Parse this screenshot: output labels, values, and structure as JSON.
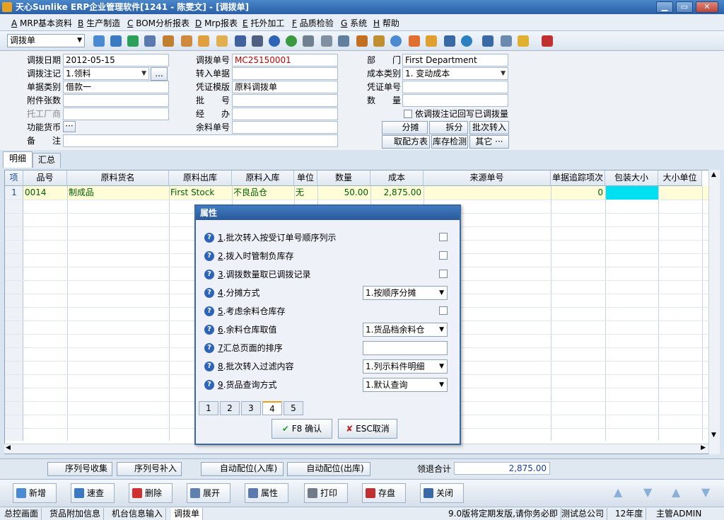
{
  "window": {
    "title": "天心Sunlike ERP企业管理软件[1241 - 陈雯文] - [调拨单]"
  },
  "menu": [
    {
      "key": "A",
      "label": "MRP基本资料"
    },
    {
      "key": "B",
      "label": "生产制造"
    },
    {
      "key": "C",
      "label": "BOM分析报表"
    },
    {
      "key": "D",
      "label": "Mrp报表"
    },
    {
      "key": "E",
      "label": "托外加工"
    },
    {
      "key": "F",
      "label": "品质检验"
    },
    {
      "key": "G",
      "label": "系统"
    },
    {
      "key": "H",
      "label": "帮助"
    }
  ],
  "toolbar": {
    "doc_type": "调拨单"
  },
  "form": {
    "date_label": "调拨日期",
    "date_value": "2012-05-15",
    "post_label": "调拨注记",
    "post_value": "1.领料",
    "post_btn": "...",
    "billtype_label": "单据类别",
    "billtype_value": "借款一",
    "attach_label": "附件张数",
    "attach_value": "",
    "tg_label": "托工厂商",
    "tg_value": "",
    "currency_label": "功能货币",
    "currency_btn": "···",
    "remark_label": "备　　注",
    "remark_value": "",
    "no_label": "调拨单号",
    "no_value": "MC25150001",
    "in_label": "转入单据",
    "in_value": "",
    "voucher_tpl_label": "凭证模版",
    "voucher_tpl_value": "原料调拨单",
    "batch_label": "批　　号",
    "batch_value": "",
    "handler_label": "经　　办",
    "handler_value": "",
    "remain_label": "余料单号",
    "remain_value": "",
    "dept_label": "部　　门",
    "dept_value": "First Department",
    "costtype_label": "成本类别",
    "costtype_value": "1. 变动成本",
    "voucher_no_label": "凭证单号",
    "voucher_no_value": "",
    "qty_label": "数　　量",
    "qty_value": "",
    "writeback_label": "依调拨注记回写已调拨量",
    "btn_split": "分摊",
    "btn_disassemble": "拆分",
    "btn_batch_in": "批次转入",
    "btn_recipe": "取配方表",
    "btn_stock_check": "库存检测",
    "btn_other": "其它 ···"
  },
  "tabs": [
    "明细",
    "汇总"
  ],
  "grid": {
    "headers": [
      "项",
      "品号",
      "原料货名",
      "原料出库",
      "原料入库",
      "单位",
      "数量",
      "成本",
      "来源单号",
      "单据追踪项次",
      "包装大小",
      "大小单位"
    ],
    "rows": [
      {
        "idx": "1",
        "code": "0014",
        "name": "制成品",
        "out": "First Stock",
        "in": "不良品仓",
        "unit": "无",
        "qty": "50.00",
        "cost": "2,875.00",
        "src": "",
        "trace": "0",
        "pack": "",
        "size_unit": ""
      }
    ]
  },
  "dialog": {
    "title": "属性",
    "items": [
      {
        "n": "1",
        "label": ".批次转入按受订单号顺序列示",
        "ctl": "check"
      },
      {
        "n": "2",
        "label": ".拨入时管制负库存",
        "ctl": "check"
      },
      {
        "n": "3",
        "label": ".调拨数量取已调拨记录",
        "ctl": "check"
      },
      {
        "n": "4",
        "label": ".分摊方式",
        "ctl": "select",
        "value": "1.按顺序分摊"
      },
      {
        "n": "5",
        "label": ".考虑余料仓库存",
        "ctl": "check"
      },
      {
        "n": "6",
        "label": ".余料仓库取值",
        "ctl": "select",
        "value": "1.货品档余料仓"
      },
      {
        "n": "7",
        "label": "汇总页面的排序",
        "ctl": "text",
        "value": ""
      },
      {
        "n": "8",
        "label": ".批次转入过滤内容",
        "ctl": "select",
        "value": "1.列示料件明细"
      },
      {
        "n": "9",
        "label": ".货品查询方式",
        "ctl": "select",
        "value": "1.默认查询"
      }
    ],
    "tabs": [
      "1",
      "2",
      "3",
      "4",
      "5"
    ],
    "ok": "F8 确认",
    "cancel": "ESC取消"
  },
  "actions": {
    "serial_collect": "序列号收集",
    "serial_fill": "序列号补入",
    "auto_in": "自动配位(入库)",
    "auto_out": "自动配位(出库)",
    "total_label": "领退合计",
    "total_value": "2,875.00"
  },
  "commands": [
    "新增",
    "速查",
    "删除",
    "展开",
    "属性",
    "打印",
    "存盘",
    "关闭"
  ],
  "status": {
    "tabs": [
      "总控画面",
      "货品附加信息",
      "机台信息输入",
      "调拨单"
    ],
    "notice": "9.0版将定期发版,请你务必即",
    "company": "测试总公司",
    "year": "12年度",
    "user": "主管ADMIN"
  }
}
